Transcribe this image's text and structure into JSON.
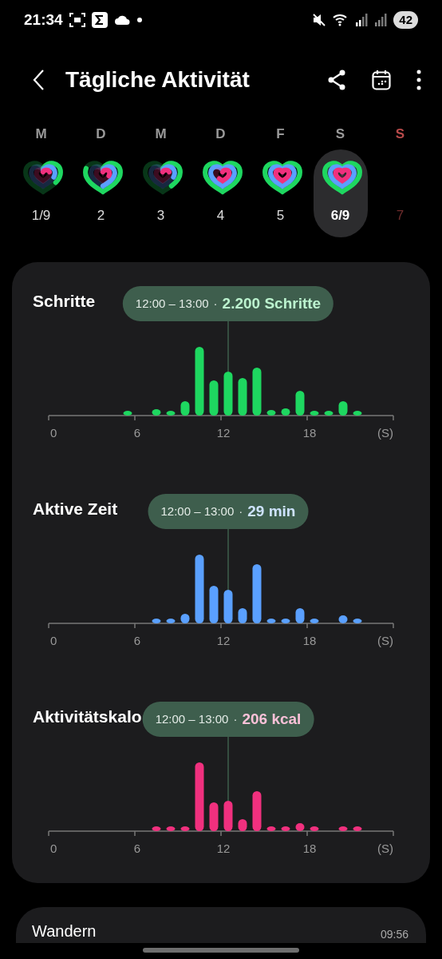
{
  "status_bar": {
    "time": "21:34",
    "battery": "42"
  },
  "header": {
    "title": "Tägliche Aktivität"
  },
  "days": [
    {
      "letter": "M",
      "date": "1/9",
      "color": "#9a9a9a",
      "selected": false,
      "disabled": false
    },
    {
      "letter": "D",
      "date": "2",
      "color": "#9a9a9a",
      "selected": false,
      "disabled": false
    },
    {
      "letter": "M",
      "date": "3",
      "color": "#9a9a9a",
      "selected": false,
      "disabled": false
    },
    {
      "letter": "D",
      "date": "4",
      "color": "#9a9a9a",
      "selected": false,
      "disabled": false
    },
    {
      "letter": "F",
      "date": "5",
      "color": "#9a9a9a",
      "selected": false,
      "disabled": false
    },
    {
      "letter": "S",
      "date": "6/9",
      "color": "#9a9a9a",
      "selected": true,
      "disabled": false
    },
    {
      "letter": "S",
      "date": "7",
      "color": "#b84a4a",
      "selected": false,
      "disabled": true
    }
  ],
  "charts": [
    {
      "title": "Schritte",
      "color": "#1ed760",
      "tooltip": {
        "time": "12:00 – 13:00",
        "separator": "·",
        "value": "2.200 Schritte"
      },
      "axis_labels": [
        "0",
        "6",
        "12",
        "18",
        "(S)"
      ]
    },
    {
      "title": "Aktive Zeit",
      "color": "#5aa0ff",
      "tooltip": {
        "time": "12:00 – 13:00",
        "separator": "·",
        "value": "29 min"
      },
      "axis_labels": [
        "0",
        "6",
        "12",
        "18",
        "(S)"
      ]
    },
    {
      "title": "Aktivitätskalo",
      "color": "#f0307e",
      "tooltip": {
        "time": "12:00 – 13:00",
        "separator": "·",
        "value": "206 kcal"
      },
      "axis_labels": [
        "0",
        "6",
        "12",
        "18",
        "(S)"
      ]
    }
  ],
  "next_card": {
    "title": "Wandern",
    "time": "09:56"
  }
}
